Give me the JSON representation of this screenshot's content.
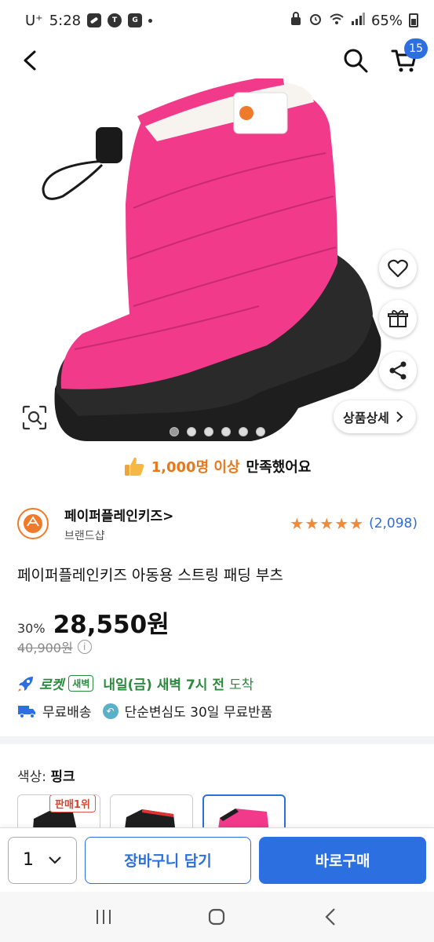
{
  "status_bar": {
    "carrier": "U⁺",
    "time": "5:28",
    "battery": "65%",
    "left_icons": [
      "clip-icon",
      "talk-icon",
      "g-icon"
    ],
    "right_icons": [
      "lock-icon",
      "alarm-icon",
      "wifi-icon",
      "signal-icon",
      "battery-icon"
    ]
  },
  "topnav": {
    "back_icon": "back-arrow-icon",
    "search_icon": "search-icon",
    "cart_icon": "cart-icon",
    "cart_count": "15"
  },
  "hero": {
    "floating_actions": [
      "heart-icon",
      "gift-icon",
      "share-icon"
    ],
    "zoom_icon": "zoom-scan-icon",
    "detail_button": "상품상세",
    "dots": 6,
    "active_dot": 0
  },
  "satisfaction": {
    "highlight": "1,000명 이상",
    "rest": "만족했어요",
    "icon": "thumbs-up-icon"
  },
  "brand": {
    "name": "페이퍼플레인키즈>",
    "sub": "브랜드샵",
    "rating_stars": 5,
    "review_count": "(2,098)"
  },
  "product": {
    "title": "페이퍼플레인키즈 아동용 스트링 패딩 부츠",
    "discount": "30%",
    "price": "28,550원",
    "original_price": "40,900원"
  },
  "delivery": {
    "rocket_label": "로켓",
    "dawn_badge": "새벽",
    "arrival": "내일(금) 새벽 7시 전",
    "arrival_end": "도착"
  },
  "shipping": {
    "free_shipping": "무료배송",
    "free_return": "단순변심도 30일 무료반품"
  },
  "options": {
    "color_label": "색상:",
    "color_value": "핑크",
    "best_badge": "판매1위",
    "selected_index": 2
  },
  "bottom_bar": {
    "quantity": "1",
    "cart_button": "장바구니 담기",
    "buy_button": "바로구매"
  },
  "colors": {
    "accent": "#2b6fe0",
    "rocket_green": "#2b8a3e",
    "star_orange": "#f08a3a",
    "boot_pink": "#f23a8a"
  }
}
